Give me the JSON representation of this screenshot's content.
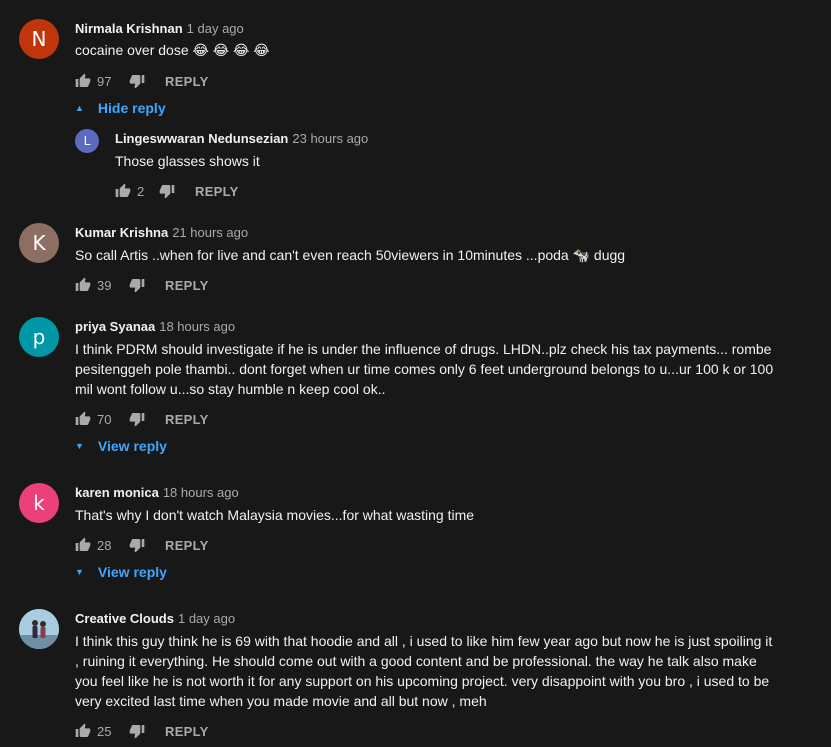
{
  "comments": [
    {
      "author": "Nirmala Krishnan",
      "time": "1 day ago",
      "avatar_letter": "N",
      "avatar_color": "#bf360c",
      "text": "cocaine over dose 😂 😂 😂 😂",
      "likes": "97",
      "reply_label": "REPLY",
      "toggle": "Hide reply",
      "replies": [
        {
          "author": "Lingeswwaran Nedunsezian",
          "time": "23 hours ago",
          "avatar_letter": "L",
          "avatar_color": "#5c6bc0",
          "text": "Those glasses shows it",
          "likes": "2",
          "reply_label": "REPLY"
        }
      ]
    },
    {
      "author": "Kumar Krishna",
      "time": "21 hours ago",
      "avatar_letter": "K",
      "avatar_color": "#8d6e63",
      "text": "So call Artis ..when for live and can't even reach 50viewers in 10minutes ...poda 🐄 dugg",
      "likes": "39",
      "reply_label": "REPLY"
    },
    {
      "author": "priya Syanaa",
      "time": "18 hours ago",
      "avatar_letter": "p",
      "avatar_color": "#0097a7",
      "text": "I think PDRM should investigate if he is under the influence of drugs. LHDN..plz check his tax payments...  rombe pesitenggeh pole thambi.. dont forget when ur time comes only 6 feet underground belongs to u...ur 100 k or 100 mil wont follow u...so stay humble n keep cool ok..",
      "likes": "70",
      "reply_label": "REPLY",
      "toggle": "View reply"
    },
    {
      "author": "karen monica",
      "time": "18 hours ago",
      "avatar_letter": "k",
      "avatar_color": "#ec407a",
      "text": "That's why I don't watch Malaysia movies...for what wasting time",
      "likes": "28",
      "reply_label": "REPLY",
      "toggle": "View reply"
    },
    {
      "author": "Creative Clouds",
      "time": "1 day ago",
      "avatar_letter": "",
      "avatar_color": "#9ec4d8",
      "text": "I think this guy think he is 69 with that hoodie and all , i used to like him few year ago but now he is just spoiling it , ruining it everything. He should come out with a good content and be professional. the way he talk also make you feel like he is not worth it for any support on his upcoming project. very disappoint with you bro , i used to be very excited last time when you made movie and all but now , meh",
      "likes": "25",
      "reply_label": "REPLY"
    }
  ],
  "icons": {
    "like": "thumbs-up-icon",
    "dislike": "thumbs-down-icon",
    "expand": "caret-icon"
  }
}
